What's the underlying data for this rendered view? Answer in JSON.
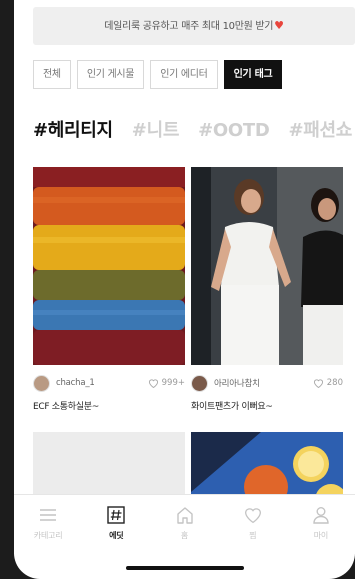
{
  "banner": {
    "text": "데일리룩 공유하고 매주 최대 10만원 받기",
    "heart": "♥"
  },
  "filters": [
    {
      "label": "전체",
      "active": false
    },
    {
      "label": "인기 게시물",
      "active": false
    },
    {
      "label": "인기 에디터",
      "active": false
    },
    {
      "label": "인기 태그",
      "active": true
    }
  ],
  "hashtags": [
    "#헤리티지",
    "#니트",
    "#OOTD",
    "#패션쇼"
  ],
  "posts": [
    {
      "user": "chacha_1",
      "likes": "999+",
      "title": "ECF 소통하실분~"
    },
    {
      "user": "아리아나참치",
      "likes": "280",
      "title": "화이트팬츠가 이뻐요~"
    }
  ],
  "tabs": [
    {
      "label": "카테고리",
      "icon": "menu-icon",
      "active": false
    },
    {
      "label": "에딧",
      "icon": "hash-icon",
      "active": true
    },
    {
      "label": "홈",
      "icon": "home-icon",
      "active": false
    },
    {
      "label": "찜",
      "icon": "heart-icon",
      "active": false
    },
    {
      "label": "마이",
      "icon": "user-icon",
      "active": false
    }
  ],
  "colors": {
    "accent": "#111111",
    "heart": "#e8453c",
    "inactive": "#c4c4c4"
  }
}
